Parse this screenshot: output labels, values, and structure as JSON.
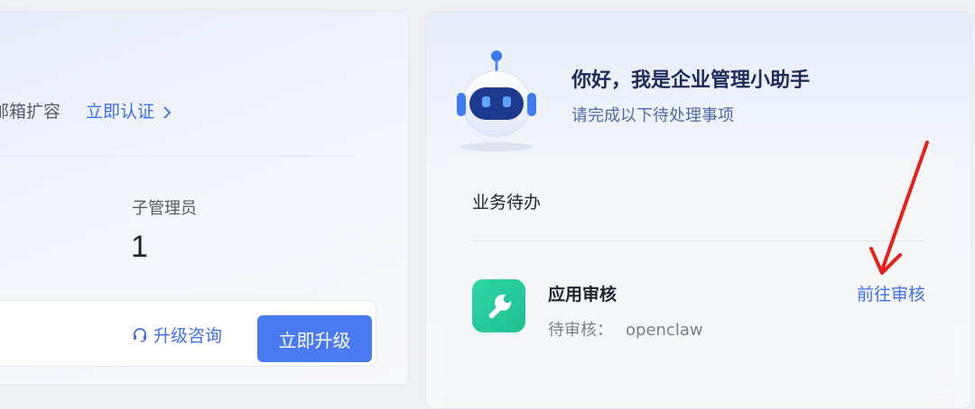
{
  "left_card": {
    "verify_text": "邮箱扩容",
    "verify_link": "立即认证",
    "stat_label": "子管理员",
    "stat_value": "1",
    "consult_label": "升级咨询",
    "upgrade_label": "立即升级"
  },
  "assistant": {
    "title": "你好，我是企业管理小助手",
    "subtitle": "请完成以下待处理事项"
  },
  "todo": {
    "title": "业务待办",
    "items": [
      {
        "title": "应用审核",
        "desc_label": "待审核：",
        "desc_value": "openclaw",
        "action": "前往审核"
      }
    ]
  },
  "colors": {
    "accent": "#3d6ff0",
    "primary_button": "#4a7af2",
    "app_icon": "#1fbf90",
    "annotation": "#e8201a"
  },
  "icons": {
    "robot": "robot-avatar",
    "headset": "headset-icon",
    "wrench": "wrench-icon",
    "chevron": "chevron-right-icon"
  }
}
